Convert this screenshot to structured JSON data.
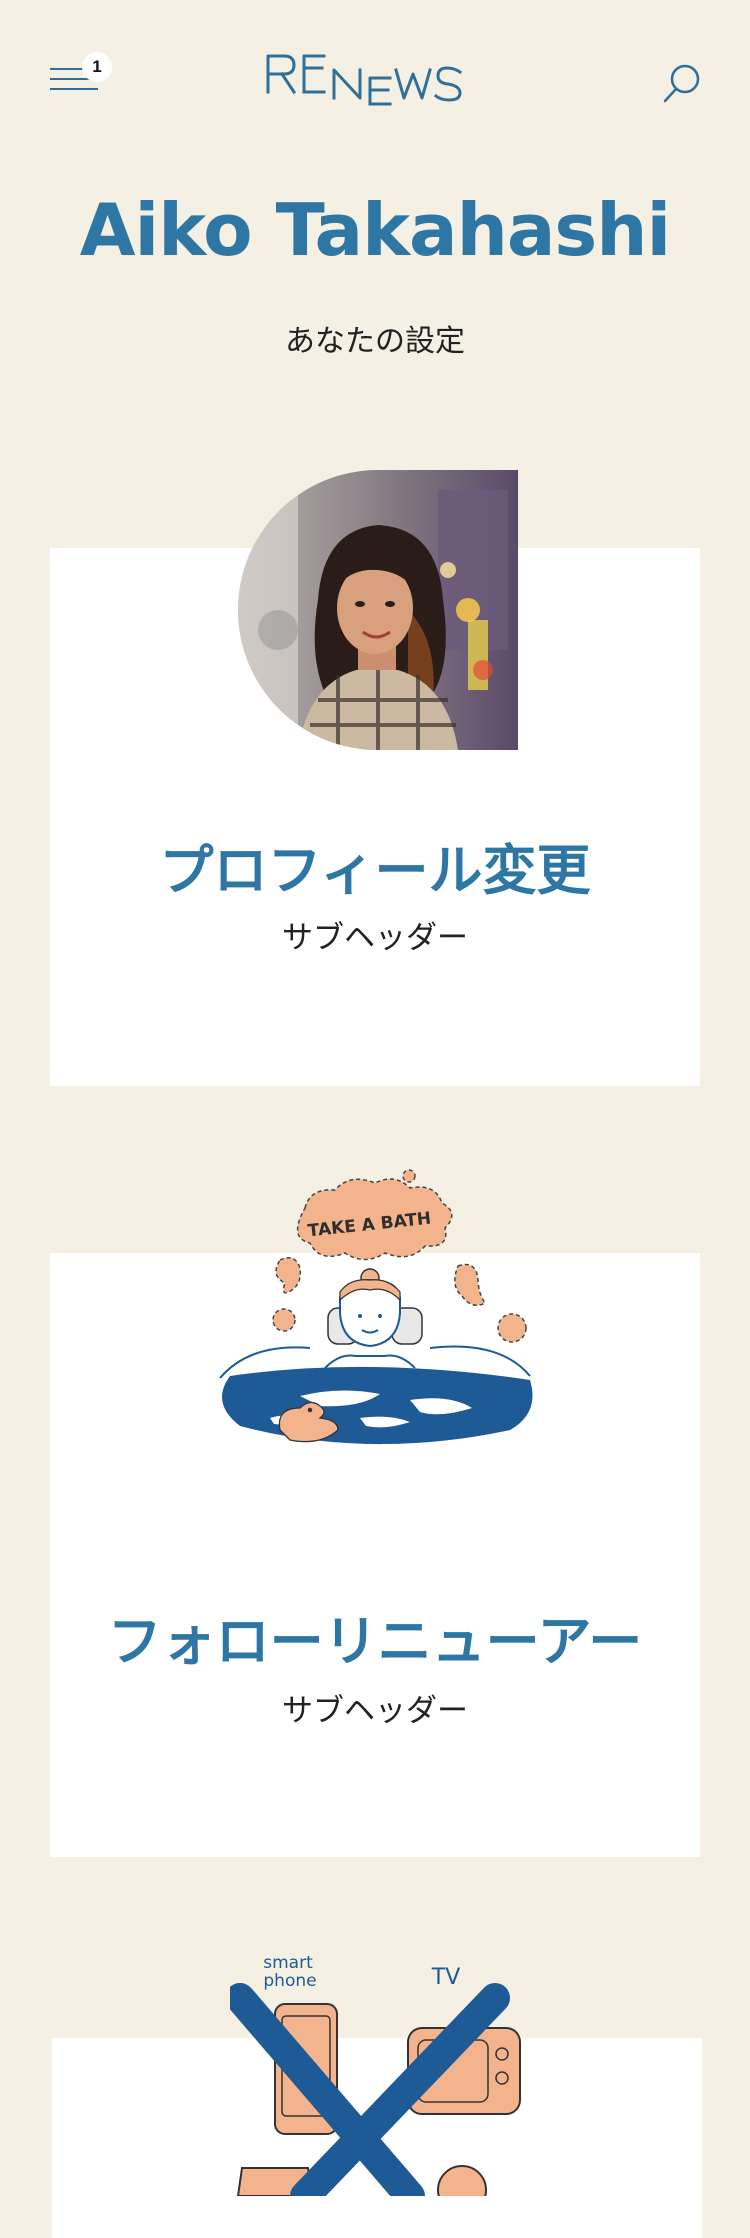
{
  "header": {
    "logo_text": "RENEWS",
    "menu_badge_count": "1"
  },
  "page": {
    "user_name": "Aiko Takahashi",
    "subtitle": "あなたの設定"
  },
  "cards": [
    {
      "title": "プロフィール変更",
      "subheader": "サブヘッダー",
      "image": "profile-photo"
    },
    {
      "title": "フォローリニューアー",
      "subheader": "サブヘッダー",
      "image": "take-a-bath-illustration"
    },
    {
      "image": "no-devices-illustration"
    }
  ],
  "illustrations": {
    "bath_bubble": "TAKE A BATH",
    "smartphone_label": "smart\nphone",
    "tv_label": "TV"
  },
  "colors": {
    "background": "#f4f0e3",
    "accent_blue": "#2e76a4",
    "card_bg": "#ffffff",
    "illustration_peach": "#f3b48d",
    "illustration_navy": "#1e5a95"
  }
}
